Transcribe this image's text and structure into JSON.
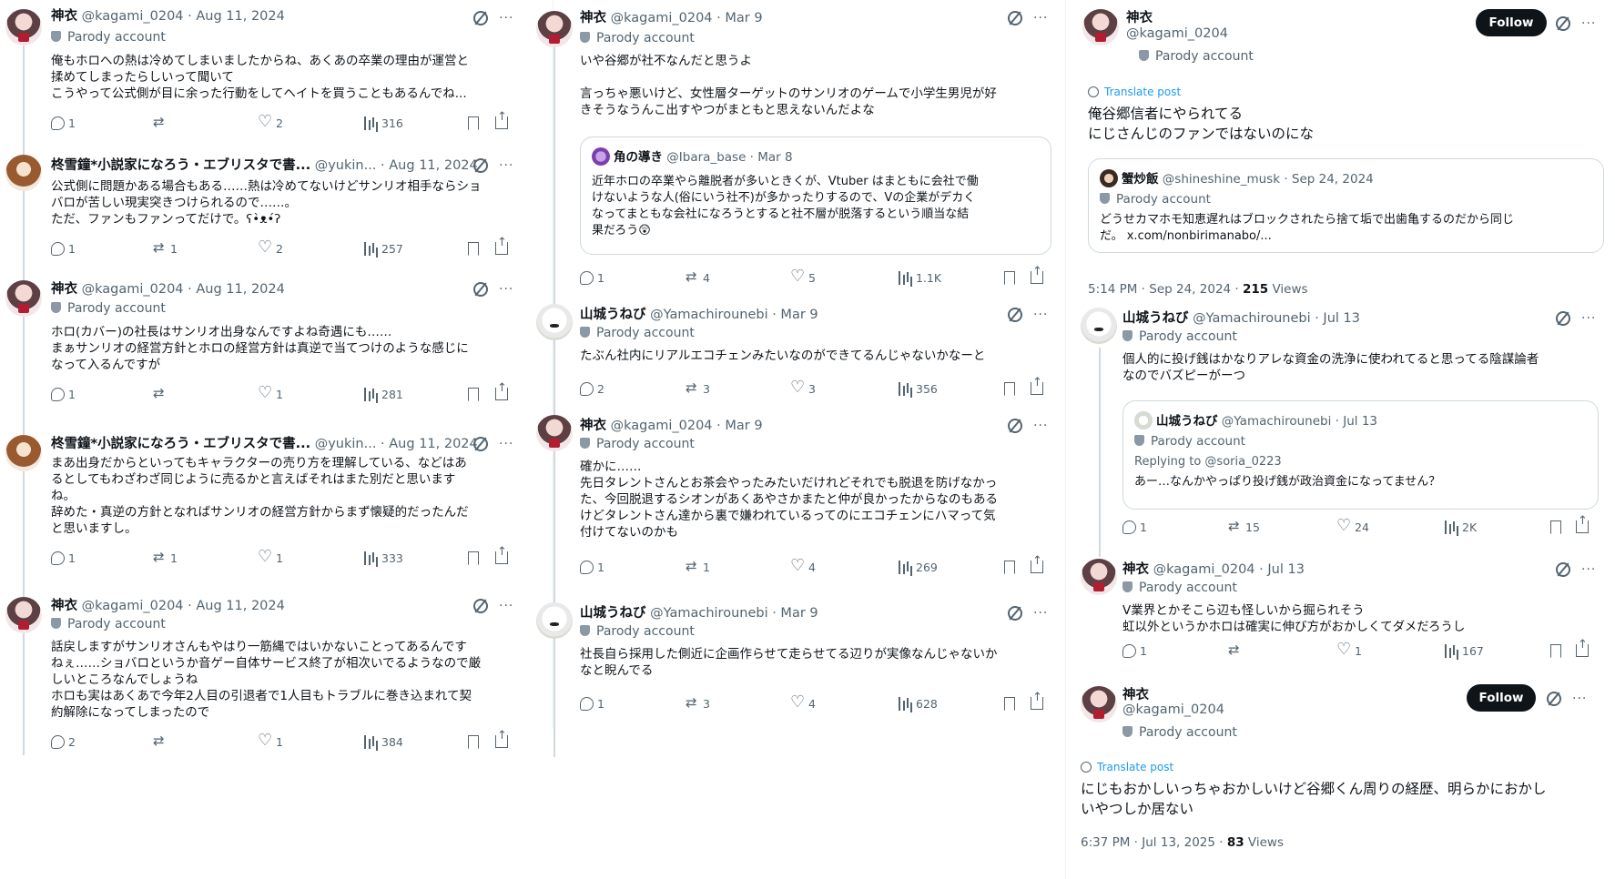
{
  "labels": {
    "parody": "Parody account",
    "follow": "Follow",
    "translate": "Translate post",
    "more": "···"
  },
  "col1": [
    {
      "name": "神衣",
      "handle": "@kagami_0204",
      "date": "· Aug 11, 2024",
      "parody": true,
      "text": "俺もホロへの熱は冷めてしまいましたからね、あくあの卒業の理由が運営と\n揉めてしまったらしいって聞いて\nこうやって公式側が目に余った行動をしてヘイトを買うこともあるんでね...",
      "reply": "1",
      "rt": "",
      "like": "2",
      "views": "316"
    },
    {
      "name": "柊雪鐘*小説家になろう・エブリスタで書...",
      "handle": "@yukin...",
      "date": "· Aug 11, 2024",
      "parody": false,
      "text": "公式側に問題かある場合もある……熱は冷めてないけどサンリオ相手ならショ\nバロが苦しい現実突きつけられるので……。\nただ、ファンもファンってだけで。ʕ•̀ᴥ•́ʔ",
      "reply": "1",
      "rt": "1",
      "like": "2",
      "views": "257"
    },
    {
      "name": "神衣",
      "handle": "@kagami_0204",
      "date": "· Aug 11, 2024",
      "parody": true,
      "text": "ホロ(カバー)の社長はサンリオ出身なんですよね奇遇にも……\nまぁサンリオの経営方針とホロの経営方針は真逆で当てつけのような感じに\nなって入るんですが",
      "reply": "1",
      "rt": "",
      "like": "1",
      "views": "281"
    },
    {
      "name": "柊雪鐘*小説家になろう・エブリスタで書...",
      "handle": "@yukin...",
      "date": "· Aug 11, 2024",
      "parody": false,
      "text": "まあ出身だからといってもキャラクターの売り方を理解している、などはあ\nるとしてもわざわざ同じように売るかと言えばそれはまた別だと思います\nね。\n辞めた・真逆の方針となればサンリオの経営方針からまず懐疑的だったんだ\nと思いますし。",
      "reply": "1",
      "rt": "1",
      "like": "1",
      "views": "333"
    },
    {
      "name": "神衣",
      "handle": "@kagami_0204",
      "date": "· Aug 11, 2024",
      "parody": true,
      "text": "話戻しますがサンリオさんもやはり一筋縄ではいかないことってあるんです\nねぇ……ショバロというか音ゲー自体サービス終了が相次いでるようなので厳\nしいところなんでしょうね\nホロも実はあくあで今年2人目の引退者で1人目もトラブルに巻き込まれて契\n約解除になってしまったので",
      "reply": "2",
      "rt": "",
      "like": "1",
      "views": "384"
    }
  ],
  "col2": [
    {
      "name": "神衣",
      "handle": "@kagami_0204",
      "date": "· Mar 9",
      "parody": true,
      "text": "いや谷郷が社不なんだと思うよ\n\n言っちゃ悪いけど、女性層ターゲットのサンリオのゲームで小学生男児が好\nきそうなうんこ出すやつがまともと思えないんだよな",
      "quote": {
        "name": "角の導き",
        "handle": "@Ibara_base",
        "date": "· Mar 8",
        "text": "近年ホロの卒業やら離脱者が多いときくが、Vtuber はまともに会社で働\nけないような人(俗にいう社不)が多かったりするので、Vの企業がデカく\nなってまともな会社になろうとすると社不層が脱落するという順当な結\n果だろう😲"
      },
      "reply": "1",
      "rt": "4",
      "like": "5",
      "views": "1.1K"
    },
    {
      "name": "山城うねび",
      "handle": "@Yamachirounebi",
      "date": "· Mar 9",
      "parody": true,
      "text": "たぶん社内にリアルエコチェンみたいなのができてるんじゃないかなーと",
      "reply": "2",
      "rt": "3",
      "like": "3",
      "views": "356"
    },
    {
      "name": "神衣",
      "handle": "@kagami_0204",
      "date": "· Mar 9",
      "parody": true,
      "text": "確かに……\n先日タレントさんとお茶会やったみたいだけれどそれでも脱退を防げなかっ\nた、今回脱退するシオンがあくあやさかまたと仲が良かったからなのもある\nけどタレントさん達から裏で嫌われているってのにエコチェンにハマって気\n付けてないのかも",
      "reply": "1",
      "rt": "1",
      "like": "4",
      "views": "269"
    },
    {
      "name": "山城うねび",
      "handle": "@Yamachirounebi",
      "date": "· Mar 9",
      "parody": true,
      "text": "社長自ら採用した側近に企画作らせて走らせてる辺りが実像なんじゃないか\nなと睨んでる",
      "reply": "1",
      "rt": "3",
      "like": "4",
      "views": "628"
    }
  ],
  "col3": {
    "main": {
      "name": "神衣",
      "handle": "@kagami_0204",
      "text": "俺谷郷信者にやられてる\nにじさんじのファンではないのにな",
      "quote": {
        "name": "蟹炒飯",
        "handle": "@shineshine_musk",
        "date": "· Sep 24, 2024",
        "text": "どうせカマホモ知恵遅れはブロックされたら捨て垢で出歯亀するのだから同じ\nだ。 x.com/nonbirimanabo/..."
      },
      "time": "5:14 PM · Sep 24, 2024 · ",
      "views": "215",
      "views_label": " Views"
    },
    "replies": [
      {
        "name": "山城うねび",
        "handle": "@Yamachirounebi",
        "date": "· Jul 13",
        "parody": true,
        "text": "個人的に投げ銭はかなりアレな資金の洗浄に使われてると思ってる陰謀論者\nなのでバズピーがーつ",
        "quote": {
          "name": "山城うねび",
          "handle": "@Yamachirounebi",
          "date": "· Jul 13",
          "replying": "Replying to @soria_0223",
          "text": "あー…なんかやっぱり投げ銭が政治資金になってません？"
        },
        "reply": "1",
        "rt": "15",
        "like": "24",
        "views": "2K"
      },
      {
        "name": "神衣",
        "handle": "@kagami_0204",
        "date": "· Jul 13",
        "parody": true,
        "text": "V業界とかそこら辺も怪しいから掘られそう\n虹以外というかホロは確実に伸び方がおかしくてダメだろうし",
        "reply": "1",
        "rt": "",
        "like": "1",
        "views": "167"
      }
    ],
    "last": {
      "name": "神衣",
      "handle": "@kagami_0204",
      "text": "にじもおかしいっちゃおかしいけど谷郷くん周りの経歴、明らかにおかし\nいやつしか居ない",
      "time": "6:37 PM · Jul 13, 2025 · ",
      "views": "83",
      "views_label": " Views"
    }
  }
}
